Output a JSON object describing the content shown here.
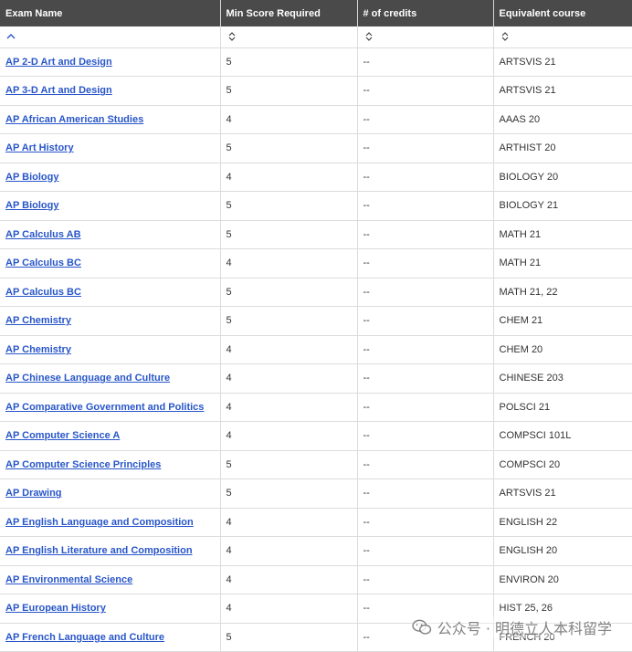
{
  "table": {
    "headers": [
      "Exam Name",
      "Min Score Required",
      "# of credits",
      "Equivalent course"
    ],
    "rows": [
      {
        "exam": "AP 2-D Art and Design",
        "score": "5",
        "credits": "--",
        "course": "ARTSVIS 21"
      },
      {
        "exam": "AP 3-D Art and Design",
        "score": "5",
        "credits": "--",
        "course": "ARTSVIS 21"
      },
      {
        "exam": "AP African American Studies",
        "score": "4",
        "credits": "--",
        "course": "AAAS 20"
      },
      {
        "exam": "AP Art History",
        "score": "5",
        "credits": "--",
        "course": "ARTHIST 20"
      },
      {
        "exam": "AP Biology",
        "score": "4",
        "credits": "--",
        "course": "BIOLOGY 20"
      },
      {
        "exam": "AP Biology",
        "score": "5",
        "credits": "--",
        "course": "BIOLOGY 21"
      },
      {
        "exam": "AP Calculus AB",
        "score": "5",
        "credits": "--",
        "course": "MATH 21"
      },
      {
        "exam": "AP Calculus BC",
        "score": "4",
        "credits": "--",
        "course": "MATH 21"
      },
      {
        "exam": "AP Calculus BC",
        "score": "5",
        "credits": "--",
        "course": "MATH 21, 22"
      },
      {
        "exam": "AP Chemistry",
        "score": "5",
        "credits": "--",
        "course": "CHEM 21"
      },
      {
        "exam": "AP Chemistry",
        "score": "4",
        "credits": "--",
        "course": "CHEM 20"
      },
      {
        "exam": "AP Chinese Language and Culture",
        "score": "4",
        "credits": "--",
        "course": "CHINESE 203"
      },
      {
        "exam": "AP Comparative Government and Politics",
        "score": "4",
        "credits": "--",
        "course": "POLSCI 21"
      },
      {
        "exam": "AP Computer Science A",
        "score": "4",
        "credits": "--",
        "course": "COMPSCI 101L"
      },
      {
        "exam": "AP Computer Science Principles",
        "score": "5",
        "credits": "--",
        "course": "COMPSCI 20"
      },
      {
        "exam": "AP Drawing",
        "score": "5",
        "credits": "--",
        "course": "ARTSVIS 21"
      },
      {
        "exam": "AP English Language and Composition",
        "score": "4",
        "credits": "--",
        "course": "ENGLISH 22"
      },
      {
        "exam": "AP English Literature and Composition",
        "score": "4",
        "credits": "--",
        "course": "ENGLISH 20"
      },
      {
        "exam": "AP Environmental Science",
        "score": "4",
        "credits": "--",
        "course": "ENVIRON 20"
      },
      {
        "exam": "AP European History",
        "score": "4",
        "credits": "--",
        "course": "HIST 25, 26"
      },
      {
        "exam": "AP French Language and Culture",
        "score": "5",
        "credits": "--",
        "course": "FRENCH 20"
      }
    ]
  },
  "sort_icons": {
    "exam": "sort-ascending-icon",
    "score": "sort-unsorted-icon",
    "credits": "sort-unsorted-icon",
    "course": "sort-unsorted-icon"
  },
  "colors": {
    "header_bg": "#4a4a4a",
    "link": "#2856c9",
    "border": "#dcdcdc"
  },
  "watermark": {
    "text": "公众号 · 明德立人本科留学",
    "icon": "wechat-icon"
  }
}
